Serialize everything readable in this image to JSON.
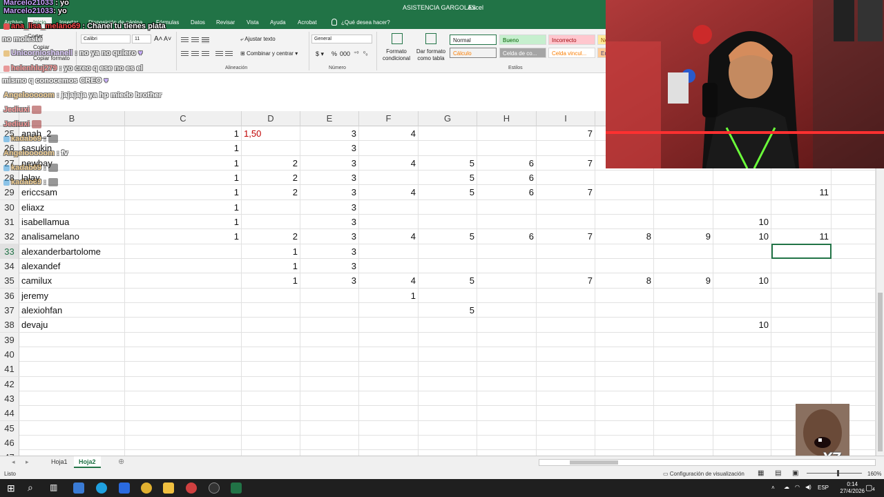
{
  "window": {
    "title": "ASISTENCIA GARGOLAS",
    "app": "Excel"
  },
  "tabs": [
    "Archivo",
    "Inicio",
    "Insertar",
    "Disposición de página",
    "Fórmulas",
    "Datos",
    "Revisar",
    "Vista",
    "Ayuda",
    "Acrobat"
  ],
  "tab_search": "¿Qué desea hacer?",
  "ribbon": {
    "clipboard": {
      "cut": "Cortar",
      "copy": "Copiar",
      "format_painter": "Copiar formato"
    },
    "font": {
      "name": "Calibri",
      "size": "11"
    },
    "alignment": {
      "wrap": "Ajustar texto",
      "merge": "Combinar y centrar",
      "label": "Alineación"
    },
    "number": {
      "format": "General",
      "label": "Número"
    },
    "styles": {
      "conditional": "Formato condicional",
      "as_table": "Dar formato como tabla",
      "label": "Estilos",
      "normal": "Normal",
      "bueno": "Bueno",
      "incorrecto": "Incorrecto",
      "neutral": "Ne",
      "calculo": "Cálculo",
      "celda_co": "Celda de co...",
      "celda_vinc": "Celda vincul...",
      "entrada": "En"
    }
  },
  "chat": [
    {
      "user": "Marcelo21033",
      "msg": ": yo"
    },
    {
      "user": "ana_lisa_melano69",
      "msg": ": Chanel tu tienes plata"
    },
    {
      "user": "",
      "msg": "no molesté"
    },
    {
      "user": "Unicornioshanell",
      "msg": ": no ya no quiero"
    },
    {
      "user": "helenhluj279",
      "msg": ": yo creo q ese no es el"
    },
    {
      "user": "",
      "msg": "mismo q conocemos CREO"
    },
    {
      "user": "Angelooooom",
      "msg": ": jajajaja ya hp miedo brother"
    },
    {
      "user": "Jediuxi",
      "msg": ""
    },
    {
      "user": "Jediuxi",
      "msg": ""
    },
    {
      "user": "kadab69",
      "msg": ":"
    },
    {
      "user": "Angelooooom",
      "msg": ": fv"
    },
    {
      "user": "kadab69",
      "msg": ":"
    },
    {
      "user": "kadab69",
      "msg": ":"
    }
  ],
  "columns": [
    "B",
    "C",
    "D",
    "E",
    "F",
    "G",
    "H",
    "I"
  ],
  "rows": [
    {
      "n": "25",
      "name": "anah_2",
      "vals": {
        "C": "1",
        "D": "1,50",
        "E": "3",
        "F": "4",
        "I": "7"
      }
    },
    {
      "n": "26",
      "name": "sasukin",
      "vals": {
        "C": "1",
        "E": "3"
      }
    },
    {
      "n": "27",
      "name": "newbay",
      "vals": {
        "C": "1",
        "D": "2",
        "E": "3",
        "F": "4",
        "G": "5",
        "H": "6",
        "I": "7"
      }
    },
    {
      "n": "28",
      "name": "lalay",
      "vals": {
        "C": "1",
        "D": "2",
        "E": "3",
        "G": "5",
        "H": "6"
      }
    },
    {
      "n": "29",
      "name": "ericcsam",
      "vals": {
        "C": "1",
        "D": "2",
        "E": "3",
        "F": "4",
        "G": "5",
        "H": "6",
        "I": "7",
        "M": "11"
      }
    },
    {
      "n": "30",
      "name": "eliaxz",
      "vals": {
        "C": "1",
        "E": "3"
      }
    },
    {
      "n": "31",
      "name": "isabellamua",
      "vals": {
        "C": "1",
        "E": "3",
        "L": "10"
      }
    },
    {
      "n": "32",
      "name": "analisamelano",
      "vals": {
        "C": "1",
        "D": "2",
        "E": "3",
        "F": "4",
        "G": "5",
        "H": "6",
        "I": "7",
        "J": "8",
        "K": "9",
        "L": "10",
        "M": "11"
      }
    },
    {
      "n": "33",
      "name": "alexanderbartolome",
      "vals": {
        "D": "1",
        "E": "3"
      }
    },
    {
      "n": "34",
      "name": "alexandef",
      "vals": {
        "D": "1",
        "E": "3"
      }
    },
    {
      "n": "35",
      "name": "camilux",
      "vals": {
        "D": "1",
        "E": "3",
        "F": "4",
        "G": "5",
        "I": "7",
        "J": "8",
        "K": "9",
        "L": "10"
      }
    },
    {
      "n": "36",
      "name": "jeremy",
      "vals": {
        "F": "1"
      }
    },
    {
      "n": "37",
      "name": "alexiohfan",
      "vals": {
        "G": "5"
      }
    },
    {
      "n": "38",
      "name": "devaju",
      "vals": {
        "L": "10"
      }
    },
    {
      "n": "39",
      "name": "",
      "vals": {}
    },
    {
      "n": "40",
      "name": "",
      "vals": {}
    },
    {
      "n": "41",
      "name": "",
      "vals": {}
    },
    {
      "n": "42",
      "name": "",
      "vals": {}
    },
    {
      "n": "43",
      "name": "",
      "vals": {}
    },
    {
      "n": "44",
      "name": "",
      "vals": {}
    },
    {
      "n": "45",
      "name": "",
      "vals": {}
    },
    {
      "n": "46",
      "name": "",
      "vals": {}
    },
    {
      "n": "47",
      "name": "",
      "vals": {}
    }
  ],
  "sheets": [
    "Hoja1",
    "Hoja2"
  ],
  "active_sheet": "Hoja2",
  "status": {
    "ready": "Listo",
    "display_settings": "Configuración de visualización",
    "zoom": "160%"
  },
  "taskbar": {
    "lang": "ESP",
    "time": "0:14",
    "date": "27/4/2026",
    "notif": "4"
  },
  "meme_caption": "X7",
  "colors": {
    "excel_green": "#217346",
    "red_value": "#c00000"
  }
}
